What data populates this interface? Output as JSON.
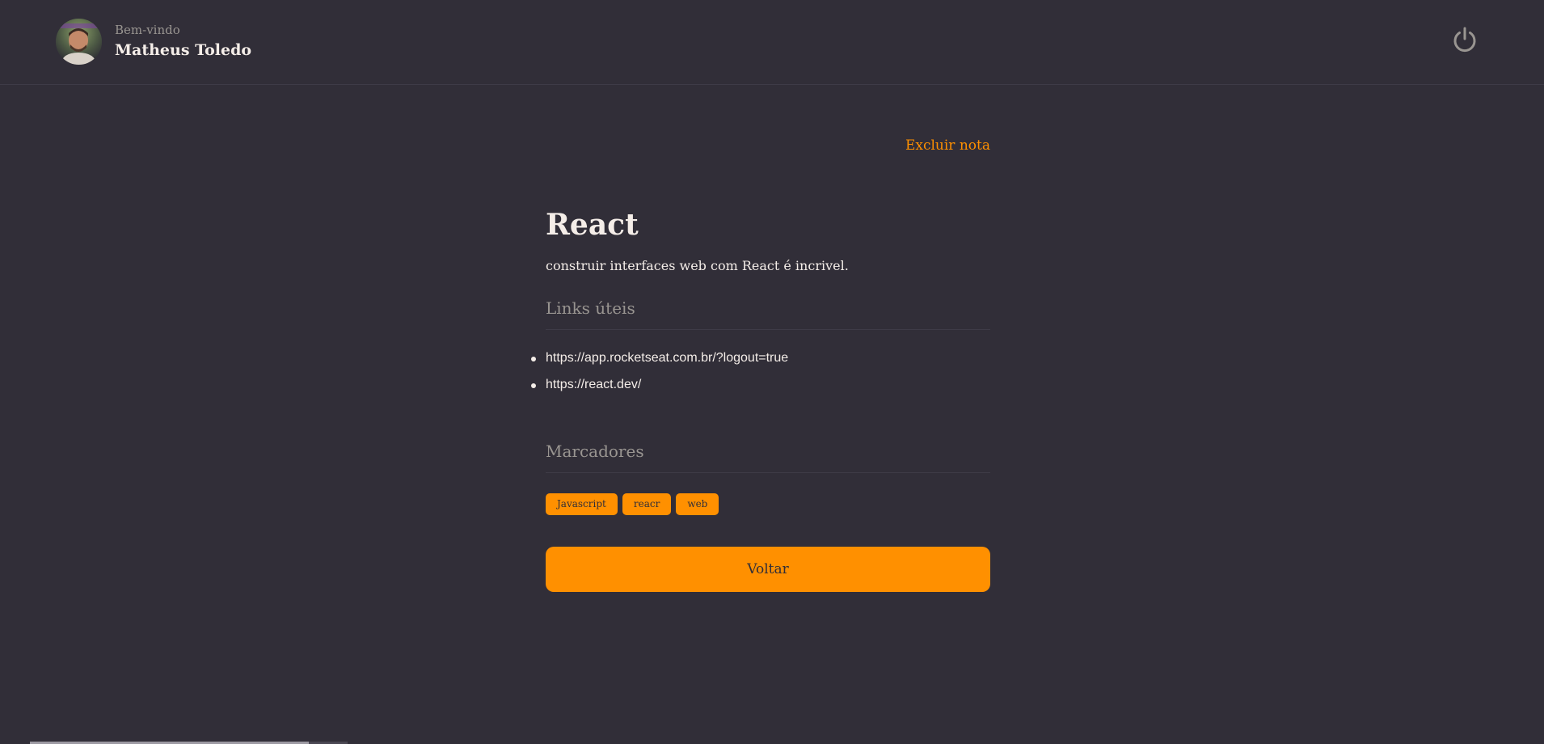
{
  "header": {
    "greeting": "Bem-vindo",
    "user_name": "Matheus Toledo",
    "avatar_icon": "user-avatar",
    "logout_icon": "power-icon"
  },
  "note": {
    "delete_label": "Excluir nota",
    "title": "React",
    "description": "construir interfaces web com React é incrivel.",
    "links_section_title": "Links úteis",
    "links": [
      "https://app.rocketseat.com.br/?logout=true",
      "https://react.dev/"
    ],
    "tags_section_title": "Marcadores",
    "tags": [
      "Javascript",
      "reacr",
      "web"
    ],
    "back_label": "Voltar"
  },
  "colors": {
    "background": "#312E38",
    "accent": "#FF9000",
    "text": "#F4EDE8",
    "muted": "#999591",
    "border": "#3E3B47"
  }
}
